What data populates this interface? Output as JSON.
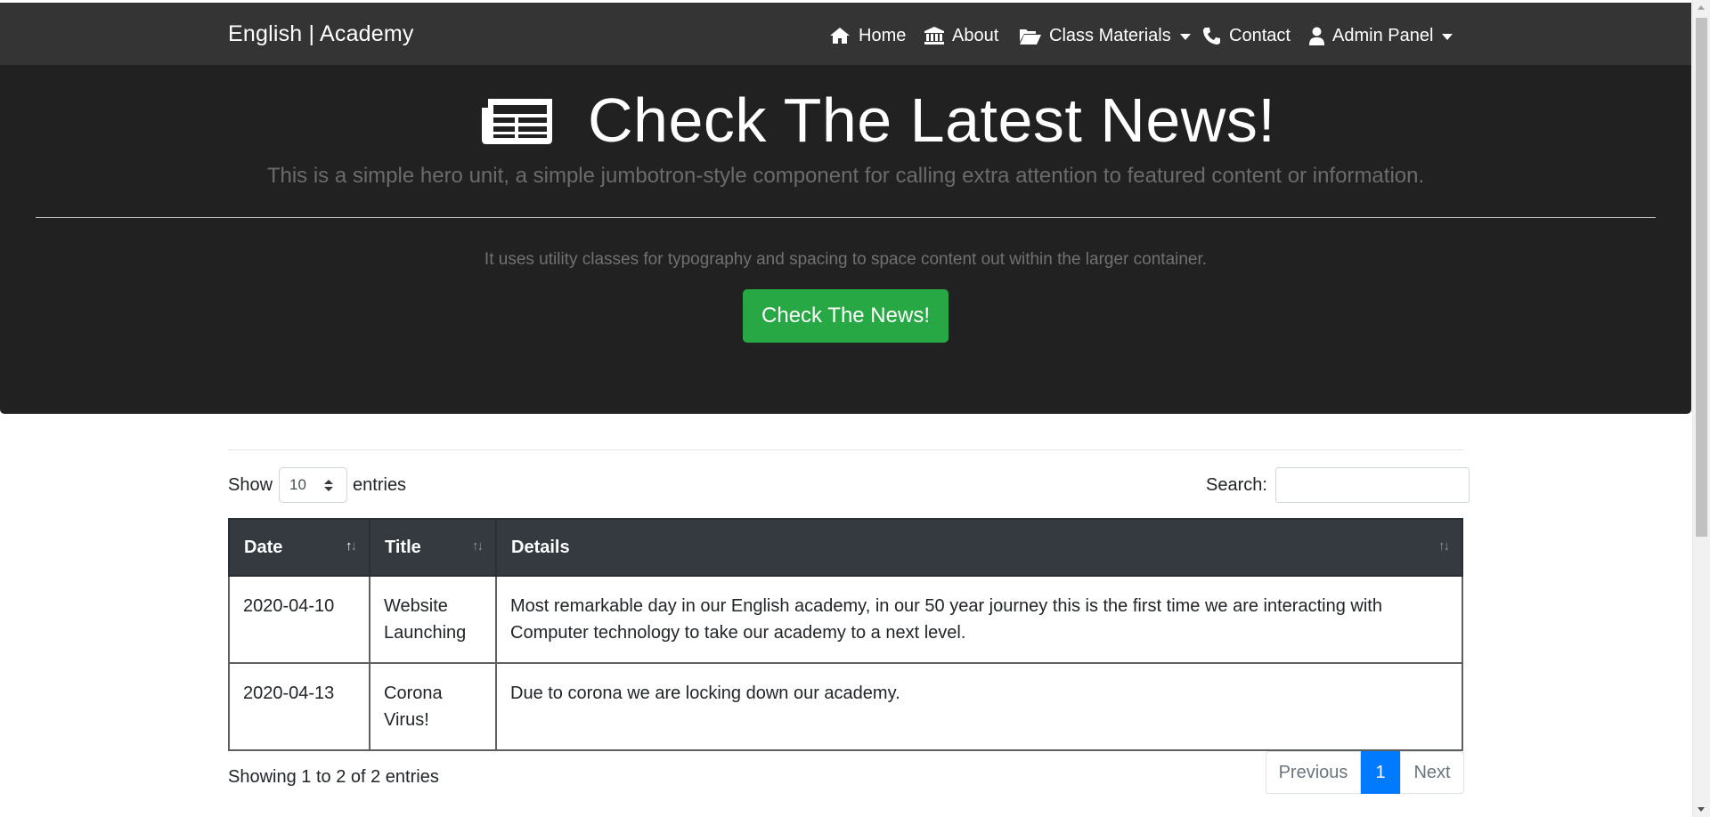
{
  "navbar": {
    "brand": "English | Academy",
    "items": [
      {
        "label": "Home",
        "icon": "home-icon"
      },
      {
        "label": "About",
        "icon": "institution-icon"
      },
      {
        "label": "Class Materials",
        "icon": "folder-open-icon"
      },
      {
        "label": "Contact",
        "icon": "phone-icon"
      },
      {
        "label": "Admin Panel",
        "icon": "user-icon"
      }
    ]
  },
  "hero": {
    "title": "Check The Latest News!",
    "lead": "This is a simple hero unit, a simple jumbotron-style component for calling extra attention to featured content or information.",
    "subtext": "It uses utility classes for typography and spacing to space content out within the larger container.",
    "button": "Check The News!",
    "button_color": "#28a745"
  },
  "table_controls": {
    "show_label": "Show",
    "entries_label": "entries",
    "length_value": "10",
    "search_label": "Search:",
    "search_value": ""
  },
  "table": {
    "columns": [
      "Date",
      "Title",
      "Details"
    ],
    "rows": [
      {
        "date": "2020-04-10",
        "title": "Website Launching",
        "details": "Most remarkable day in our English academy, in our 50 year journey this is the first time we are interacting with Computer technology to take our academy to a next level."
      },
      {
        "date": "2020-04-13",
        "title": "Corona Virus!",
        "details": "Due to corona we are locking down our academy."
      }
    ]
  },
  "footer": {
    "info": "Showing 1 to 2 of 2 entries",
    "previous": "Previous",
    "page": "1",
    "next": "Next",
    "active_color": "#007bff"
  }
}
